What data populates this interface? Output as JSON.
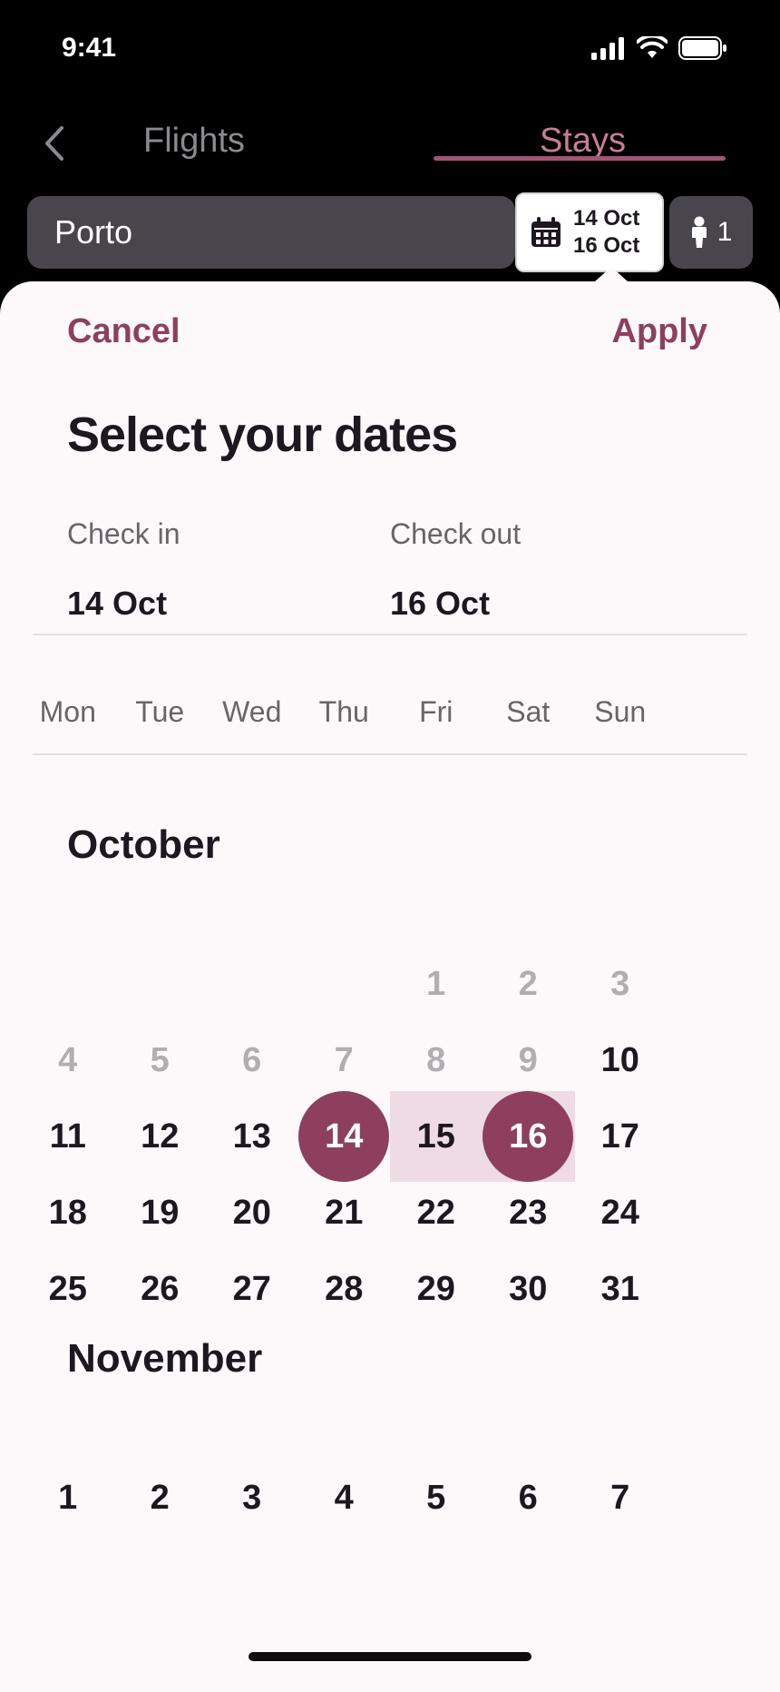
{
  "status": {
    "time": "9:41"
  },
  "nav": {
    "tab_flights": "Flights",
    "tab_stays": "Stays"
  },
  "search": {
    "destination": "Porto",
    "date_in": "14 Oct",
    "date_out": "16 Oct",
    "guests": "1"
  },
  "sheet": {
    "cancel_label": "Cancel",
    "apply_label": "Apply",
    "title": "Select your dates",
    "check_in_label": "Check in",
    "check_in_value": "14 Oct",
    "check_out_label": "Check out",
    "check_out_value": "16 Oct"
  },
  "weekdays": [
    "Mon",
    "Tue",
    "Wed",
    "Thu",
    "Fri",
    "Sat",
    "Sun"
  ],
  "months": [
    {
      "name": "October",
      "weeks": [
        [
          "",
          "",
          "",
          "",
          "1",
          "2",
          "3"
        ],
        [
          "4",
          "5",
          "6",
          "7",
          "8",
          "9",
          "10"
        ],
        [
          "11",
          "12",
          "13",
          "14",
          "15",
          "16",
          "17"
        ],
        [
          "18",
          "19",
          "20",
          "21",
          "22",
          "23",
          "24"
        ],
        [
          "25",
          "26",
          "27",
          "28",
          "29",
          "30",
          "31"
        ]
      ]
    },
    {
      "name": "November",
      "weeks": [
        [
          "1",
          "2",
          "3",
          "4",
          "5",
          "6",
          "7"
        ]
      ]
    }
  ],
  "colors": {
    "accent": "#8e3f5d",
    "range": "#efdbe3",
    "stays_tab": "#c77d9b"
  }
}
